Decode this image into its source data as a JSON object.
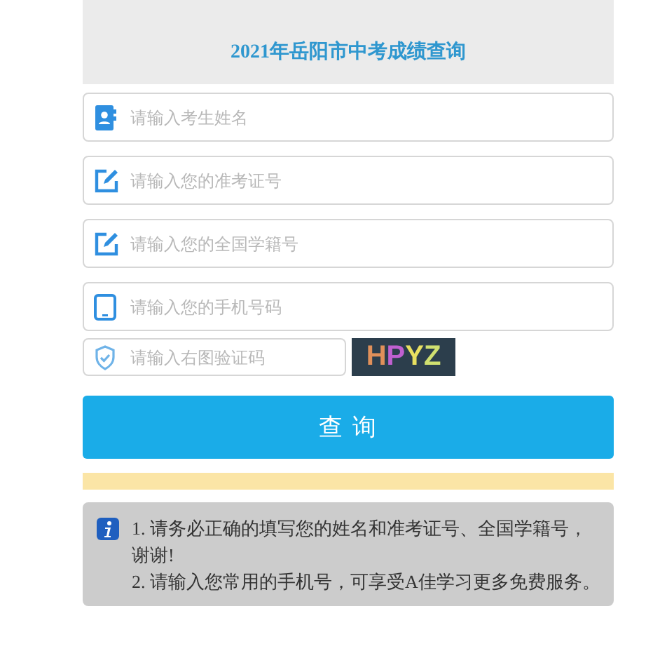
{
  "header": {
    "title": "2021年岳阳市中考成绩查询"
  },
  "fields": [
    {
      "kind": "contact",
      "placeholder": "请输入考生姓名"
    },
    {
      "kind": "edit",
      "placeholder": "请输入您的准考证号"
    },
    {
      "kind": "edit",
      "placeholder": "请输入您的全国学籍号"
    },
    {
      "kind": "phone",
      "placeholder": "请输入您的手机号码"
    }
  ],
  "captcha": {
    "placeholder": "请输入右图验证码",
    "code": "HPYZ"
  },
  "submit_button": "查 询",
  "notice": {
    "lines": [
      "1. 请务必正确的填写您的姓名和准考证号、全国学籍号，谢谢!",
      "2. 请输入您常用的手机号，可享受A佳学习更多免费服务。"
    ]
  }
}
